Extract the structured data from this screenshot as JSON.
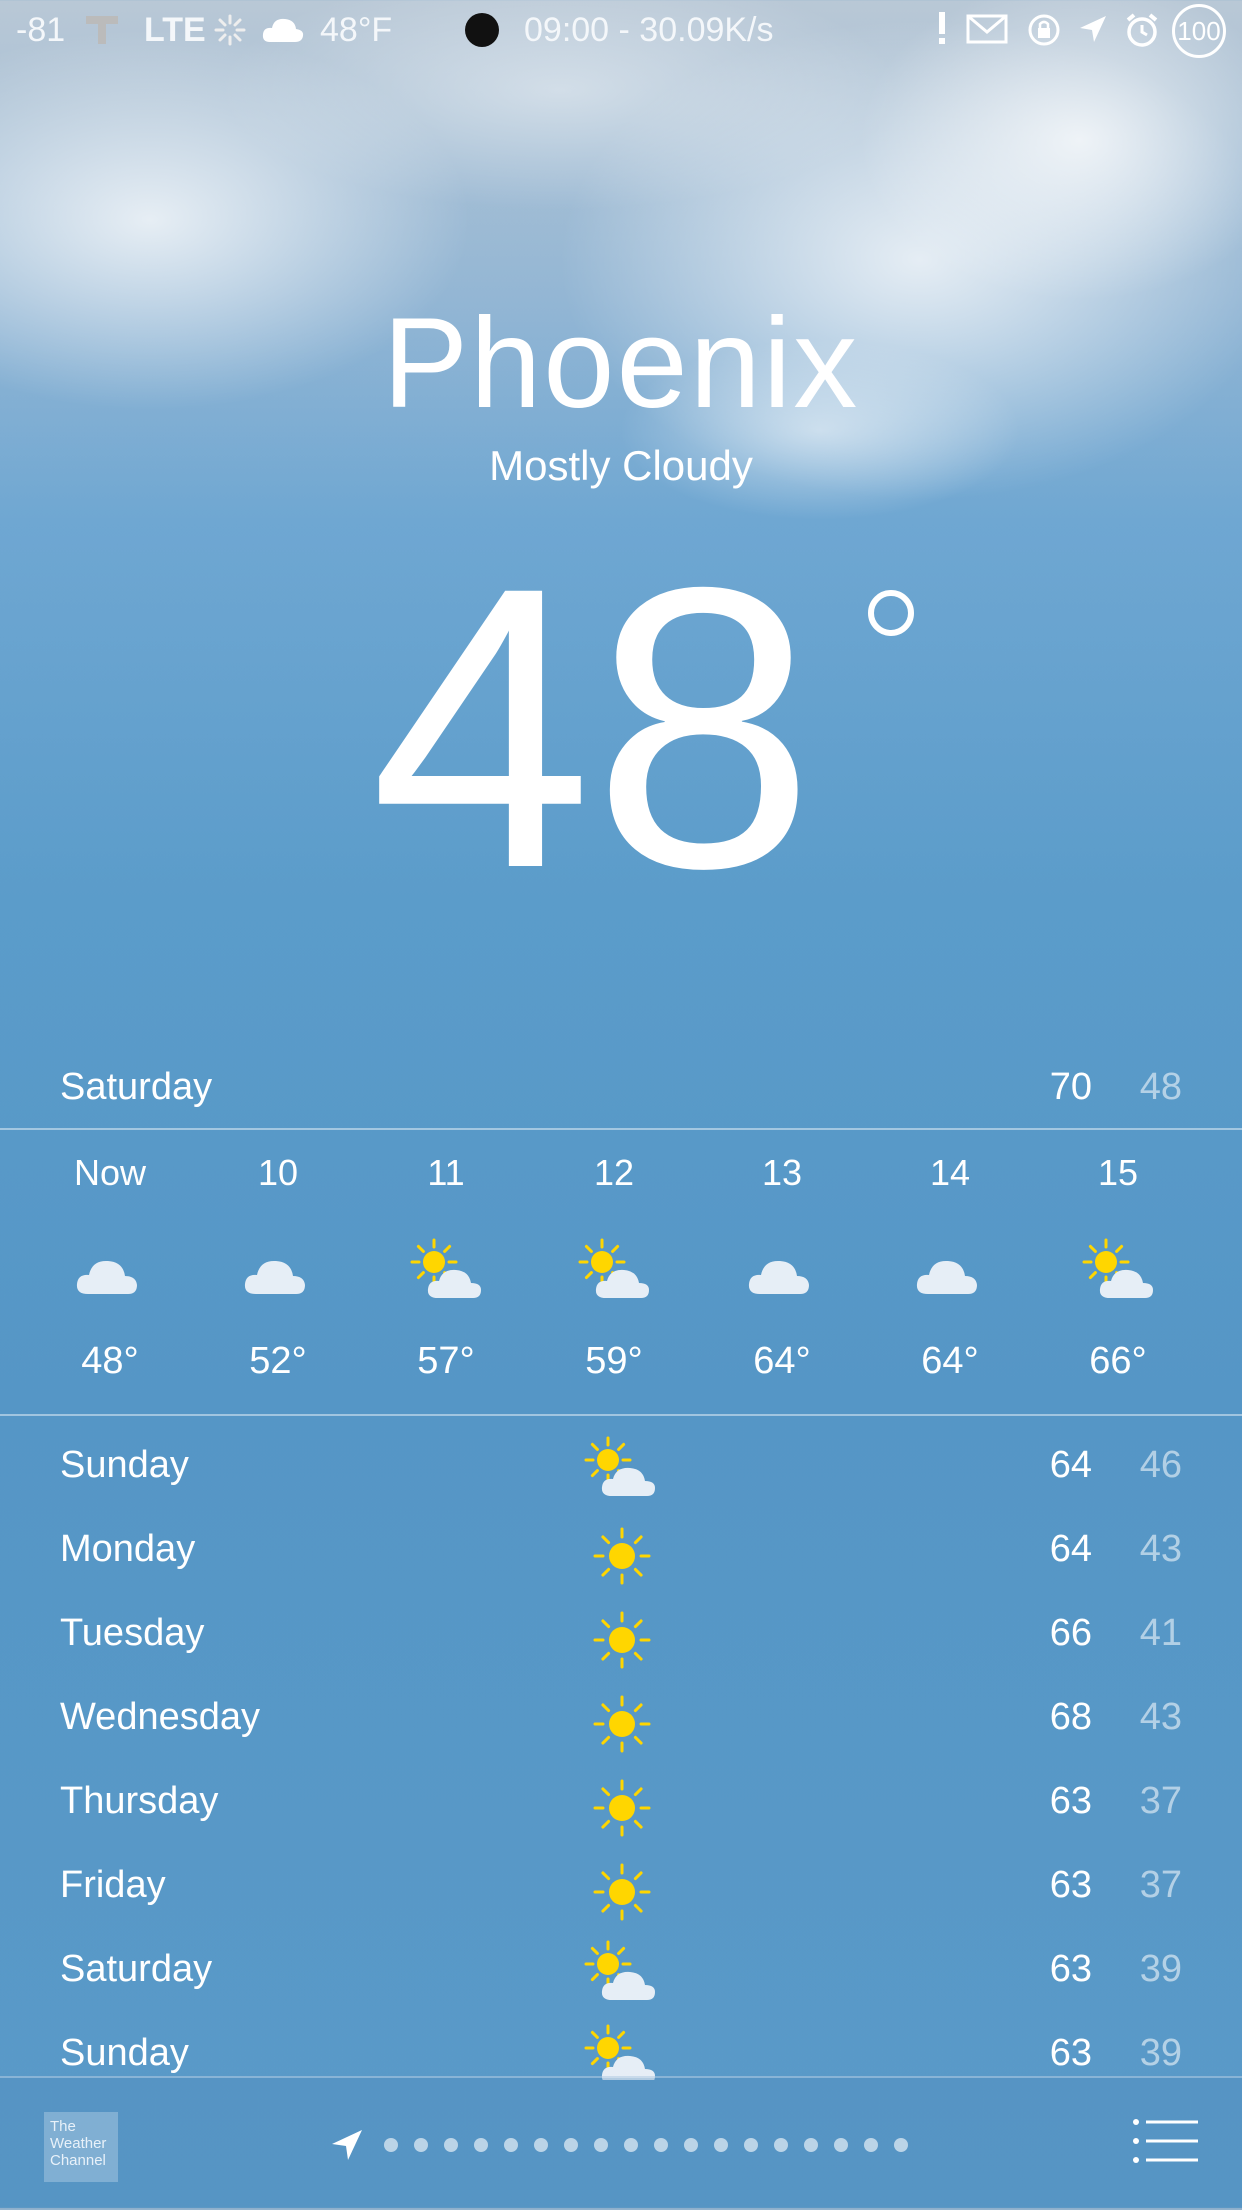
{
  "status_bar": {
    "signal": "-81",
    "carrier_icon": "t-mobile-icon",
    "network": "LTE",
    "temp": "48°F",
    "clock": "09:00 - 30.09K/s",
    "battery": "100"
  },
  "location": {
    "city": "Phoenix",
    "condition": "Mostly Cloudy",
    "temperature": "48"
  },
  "today": {
    "day": "Saturday",
    "high": "70",
    "low": "48"
  },
  "hourly": [
    {
      "time": "Now",
      "icon": "cloud-icon",
      "temp": "48°"
    },
    {
      "time": "10",
      "icon": "cloud-icon",
      "temp": "52°"
    },
    {
      "time": "11",
      "icon": "partly-sunny-icon",
      "temp": "57°"
    },
    {
      "time": "12",
      "icon": "partly-sunny-icon",
      "temp": "59°"
    },
    {
      "time": "13",
      "icon": "cloud-icon",
      "temp": "64°"
    },
    {
      "time": "14",
      "icon": "cloud-icon",
      "temp": "64°"
    },
    {
      "time": "15",
      "icon": "partly-sunny-icon",
      "temp": "66°"
    }
  ],
  "daily": [
    {
      "day": "Sunday",
      "icon": "partly-sunny-icon",
      "high": "64",
      "low": "46"
    },
    {
      "day": "Monday",
      "icon": "sun-icon",
      "high": "64",
      "low": "43"
    },
    {
      "day": "Tuesday",
      "icon": "sun-icon",
      "high": "66",
      "low": "41"
    },
    {
      "day": "Wednesday",
      "icon": "sun-icon",
      "high": "68",
      "low": "43"
    },
    {
      "day": "Thursday",
      "icon": "sun-icon",
      "high": "63",
      "low": "37"
    },
    {
      "day": "Friday",
      "icon": "sun-icon",
      "high": "63",
      "low": "37"
    },
    {
      "day": "Saturday",
      "icon": "partly-sunny-icon",
      "high": "63",
      "low": "39"
    },
    {
      "day": "Sunday",
      "icon": "partly-sunny-icon",
      "high": "63",
      "low": "39"
    }
  ],
  "footer": {
    "brand_text": "The Weather Channel",
    "page_count": 18,
    "current_page": 0
  },
  "colors": {
    "sky": "#5596c6",
    "sun": "#ffd600",
    "cloud": "#e6eef6"
  }
}
